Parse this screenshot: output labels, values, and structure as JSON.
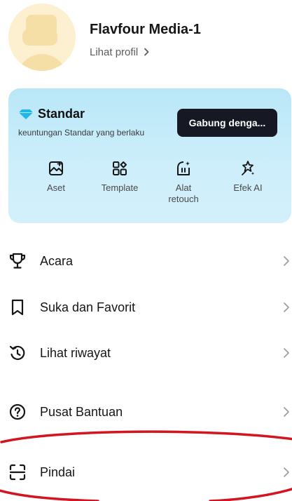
{
  "profile": {
    "name": "Flavfour Media-1",
    "link_label": "Lihat profil"
  },
  "membership": {
    "tier_name": "Standar",
    "subtitle": "keuntungan Standar yang berlaku",
    "join_label": "Gabung denga...",
    "accent_color": "#1fb7e8",
    "features": [
      {
        "label": "Aset",
        "icon": "asset-icon"
      },
      {
        "label": "Template",
        "icon": "template-icon"
      },
      {
        "label": "Alat retouch",
        "icon": "retouch-icon"
      },
      {
        "label": "Efek AI",
        "icon": "ai-effect-icon"
      }
    ]
  },
  "menu": {
    "items": [
      {
        "label": "Acara",
        "icon": "trophy-icon"
      },
      {
        "label": "Suka dan Favorit",
        "icon": "bookmark-icon"
      },
      {
        "label": "Lihat riwayat",
        "icon": "history-icon"
      },
      {
        "label": "Pusat Bantuan",
        "icon": "help-icon"
      },
      {
        "label": "Pindai",
        "icon": "scan-icon"
      }
    ]
  },
  "annotation": {
    "color": "#d4141f"
  }
}
